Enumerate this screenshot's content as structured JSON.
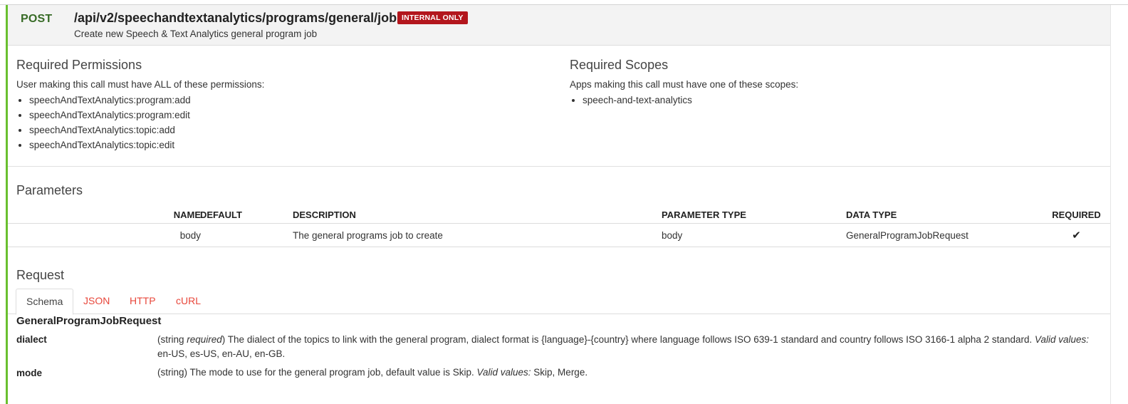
{
  "endpoint": {
    "method": "POST",
    "path": "/api/v2/speechandtextanalytics/programs/general/jobs",
    "badge": "INTERNAL ONLY",
    "summary": "Create new Speech & Text Analytics general program job"
  },
  "permissions": {
    "title": "Required Permissions",
    "intro": "User making this call must have ALL of these permissions:",
    "items": [
      "speechAndTextAnalytics:program:add",
      "speechAndTextAnalytics:program:edit",
      "speechAndTextAnalytics:topic:add",
      "speechAndTextAnalytics:topic:edit"
    ]
  },
  "scopes": {
    "title": "Required Scopes",
    "intro": "Apps making this call must have one of these scopes:",
    "items": [
      "speech-and-text-analytics"
    ]
  },
  "parameters": {
    "title": "Parameters",
    "headers": {
      "name": "NAME",
      "default": "DEFAULT",
      "description": "DESCRIPTION",
      "param_type": "PARAMETER TYPE",
      "data_type": "DATA TYPE",
      "required": "REQUIRED"
    },
    "rows": [
      {
        "name": "body",
        "default": "",
        "description": "The general programs job to create",
        "param_type": "body",
        "data_type": "GeneralProgramJobRequest",
        "required": "✔"
      }
    ]
  },
  "request": {
    "title": "Request",
    "tabs": [
      "Schema",
      "JSON",
      "HTTP",
      "cURL"
    ],
    "active_tab": "Schema",
    "model_name": "GeneralProgramJobRequest",
    "fields": [
      {
        "name": "dialect",
        "type_prefix": "(string ",
        "required_word": "required",
        "desc": ") The dialect of the topics to link with the general program, dialect format is {language}-{country} where language follows ISO 639-1 standard and country follows ISO 3166-1 alpha 2 standard. ",
        "valid_label": "Valid values:",
        "valid_values": " en-US, es-US, en-AU, en-GB."
      },
      {
        "name": "mode",
        "desc": "(string) The mode to use for the general program job, default value is Skip. ",
        "valid_label": "Valid values:",
        "valid_values": " Skip, Merge."
      }
    ]
  },
  "colors": {
    "accent_green": "#69bf2f",
    "method_green": "#376b26",
    "badge_red": "#b3161d",
    "tab_red": "#e8473b"
  }
}
